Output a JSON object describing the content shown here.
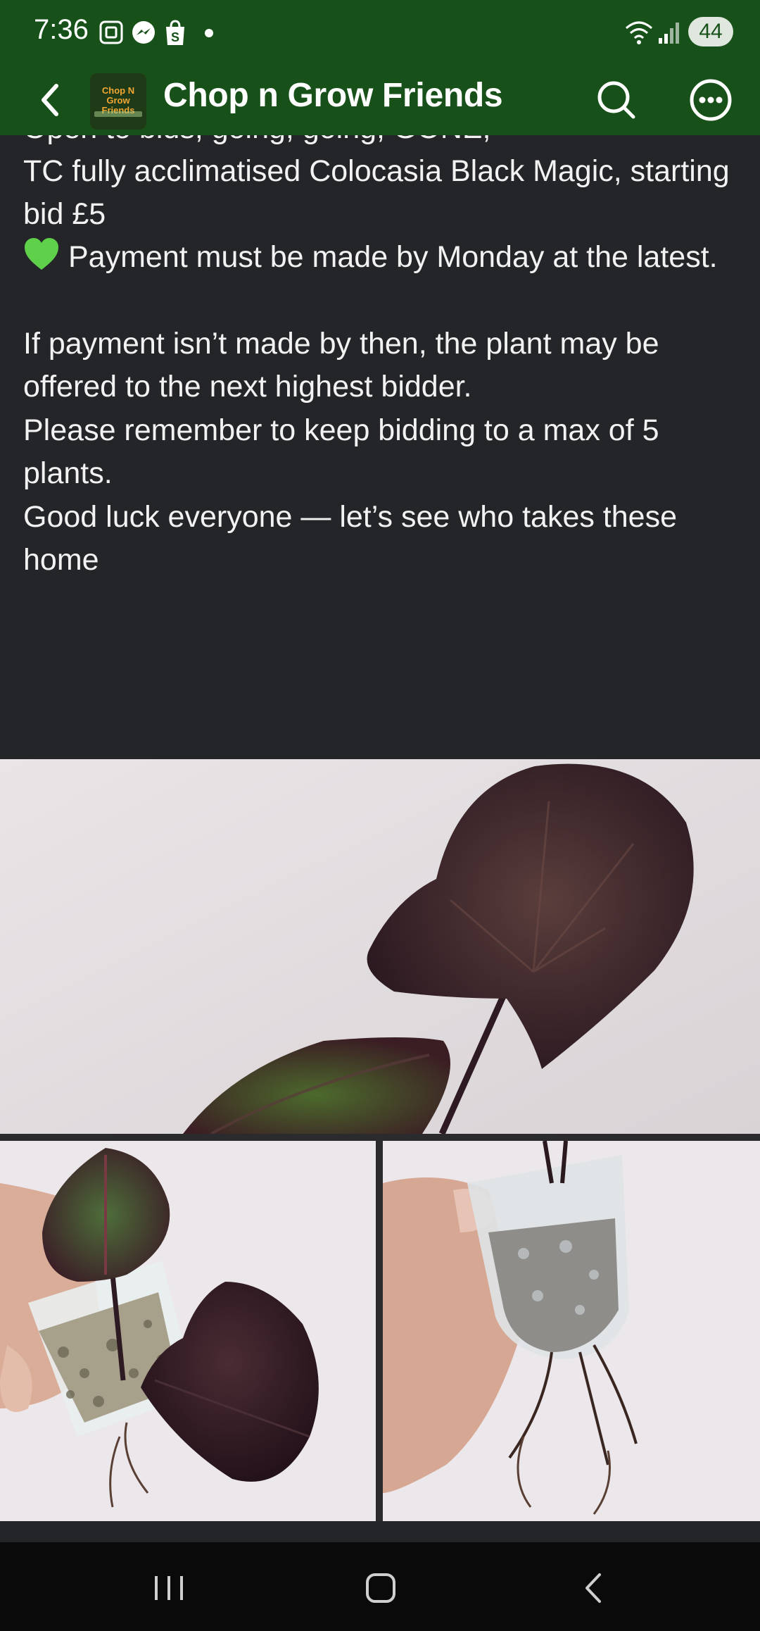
{
  "status_bar": {
    "time": "7:36",
    "battery": "44"
  },
  "app_bar": {
    "title": "Chop n Grow Friends",
    "logo_text": "Chop N Grow Friends"
  },
  "post": {
    "cut_line": "Open to bids, going, going, GONE,",
    "line_item": "TC fully acclimatised Colocasia Black Magic, starting bid £5",
    "payment": "Payment must be made by Monday at the latest.",
    "next_bidder": "If payment isn’t made by then, the plant may be offered to the next highest bidder.",
    "max_plants": "Please remember to keep bidding to a max of 5 plants.",
    "good_luck": "Good luck everyone — let’s see who takes these home"
  },
  "icons": {
    "back": "chevron-left-icon",
    "search": "search-icon",
    "more": "more-options-icon",
    "heart": "green-heart-emoji",
    "nav_recents": "recents-icon",
    "nav_home": "home-icon",
    "nav_back": "back-icon"
  },
  "colors": {
    "app_bar": "#175119",
    "background": "#242528",
    "heart": "#5fd04a"
  }
}
